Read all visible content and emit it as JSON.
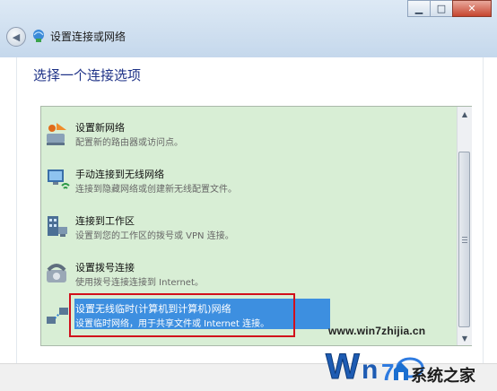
{
  "window": {
    "controls": [
      "minimize",
      "maximize",
      "close"
    ],
    "nav_title": "设置连接或网络"
  },
  "page": {
    "heading": "选择一个连接选项"
  },
  "options": [
    {
      "title": "设置新网络",
      "description": "配置新的路由器或访问点。",
      "icon": "new-network-icon",
      "selected": false
    },
    {
      "title": "手动连接到无线网络",
      "description": "连接到隐藏网络或创建新无线配置文件。",
      "icon": "wireless-manual-icon",
      "selected": false
    },
    {
      "title": "连接到工作区",
      "description": "设置到您的工作区的拨号或 VPN 连接。",
      "icon": "workplace-icon",
      "selected": false
    },
    {
      "title": "设置拨号连接",
      "description": "使用拨号连接连接到 Internet。",
      "icon": "dialup-phone-icon",
      "selected": false
    },
    {
      "title": "设置无线临时(计算机到计算机)网络",
      "description": "设置临时网络，用于共享文件或 Internet 连接。",
      "icon": "adhoc-network-icon",
      "selected": true
    }
  ],
  "watermark": {
    "url": "www.win7zhijia.cn",
    "brand": "系统之家"
  },
  "colors": {
    "listbox_bg": "#d8eed5",
    "selection_bg": "#3d8fe0",
    "annotation_border": "#d1101c",
    "heading": "#1e3287"
  }
}
